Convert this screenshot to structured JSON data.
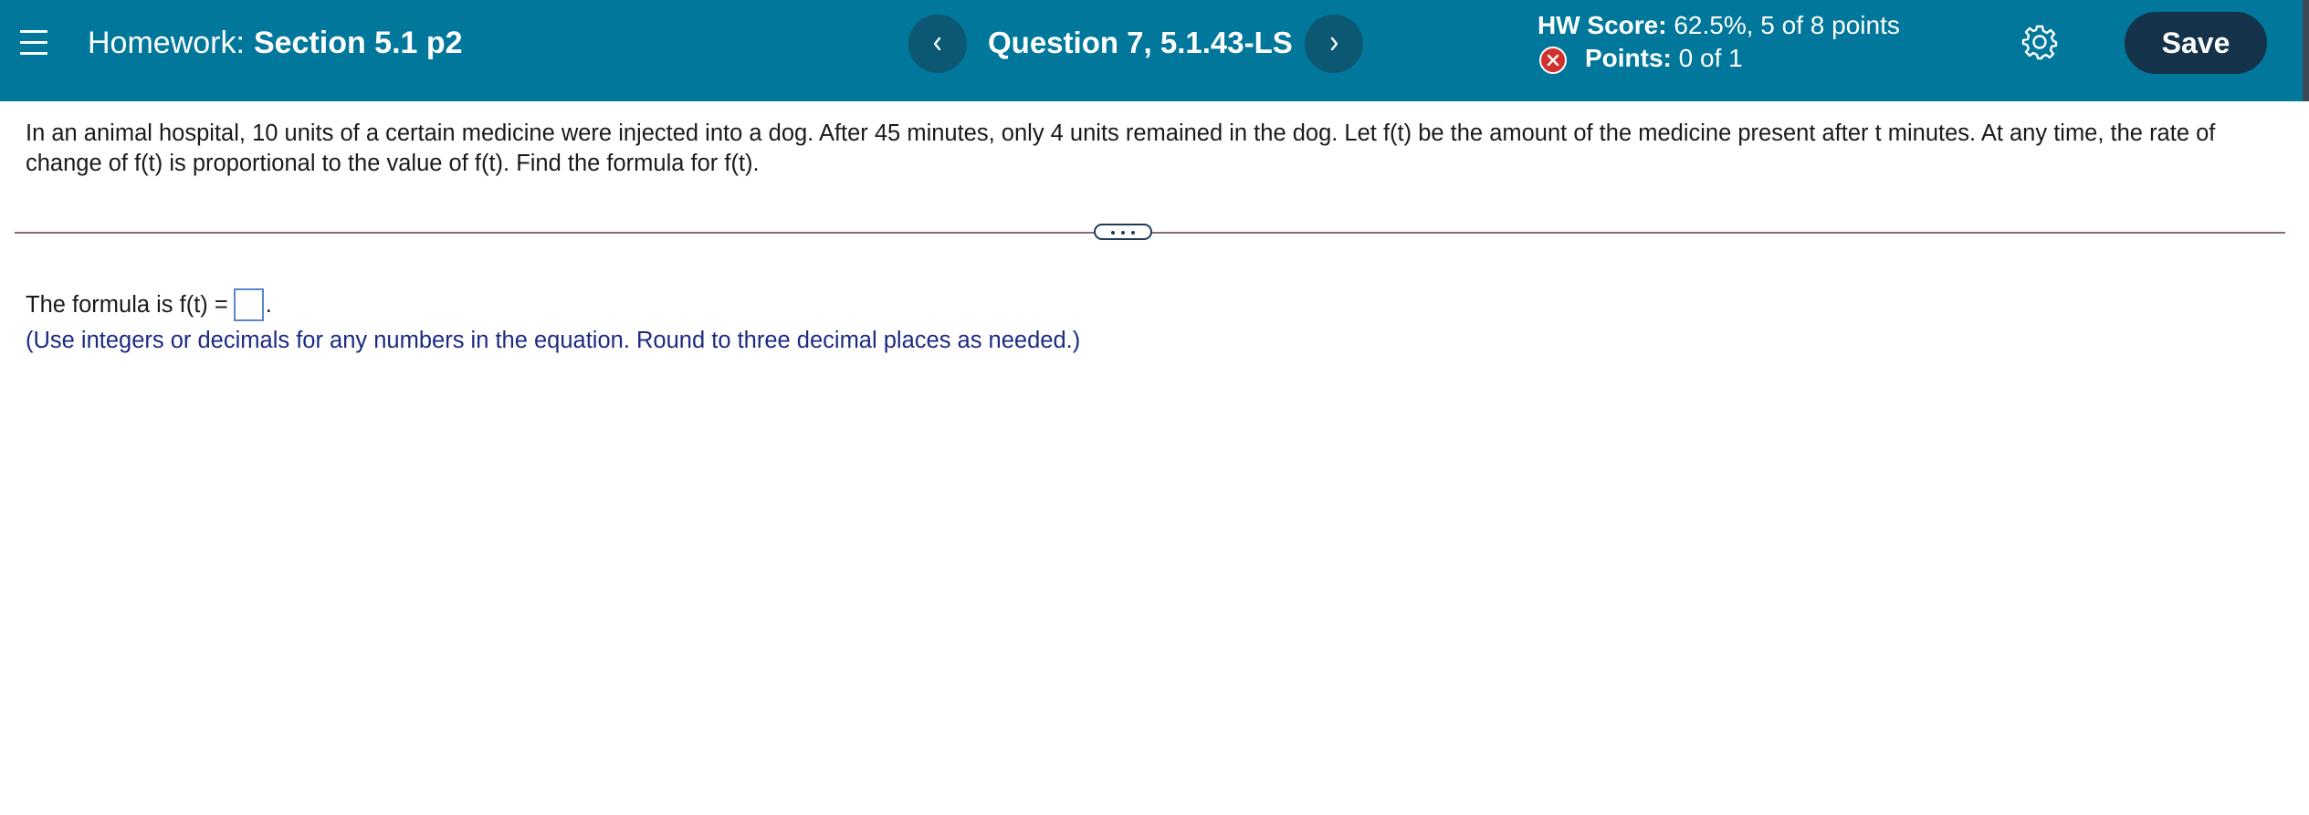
{
  "header": {
    "homework_prefix": "Homework:",
    "section_title": "Section 5.1 p2",
    "question_title": "Question 7, 5.1.43-LS",
    "prev_icon": "chevron-left-icon",
    "next_icon": "chevron-right-icon",
    "menu_icon": "hamburger-menu-icon",
    "settings_icon": "gear-icon",
    "save_label": "Save",
    "hw_score_label": "HW Score:",
    "hw_score_value": "62.5%, 5 of 8 points",
    "points_label": "Points:",
    "points_value": "0 of 1",
    "points_status_icon": "x-circle-icon",
    "colors": {
      "bar": "#00779b",
      "nav_button": "#0c5872",
      "save_button": "#14324a",
      "incorrect": "#d0312d"
    }
  },
  "question": {
    "text": "In an animal hospital, 10 units of a certain medicine were injected into a dog. After 45 minutes, only 4 units remained in the dog. Let f(t) be the amount of the medicine present after t minutes. At any time, the rate of change of f(t) is proportional to the value of f(t). Find the formula for f(t)."
  },
  "answer": {
    "prompt": "The formula is f(t) =",
    "value": "",
    "trailing": ".",
    "hint": "(Use integers or decimals for any numbers in the equation. Round to three decimal places as needed.)"
  }
}
